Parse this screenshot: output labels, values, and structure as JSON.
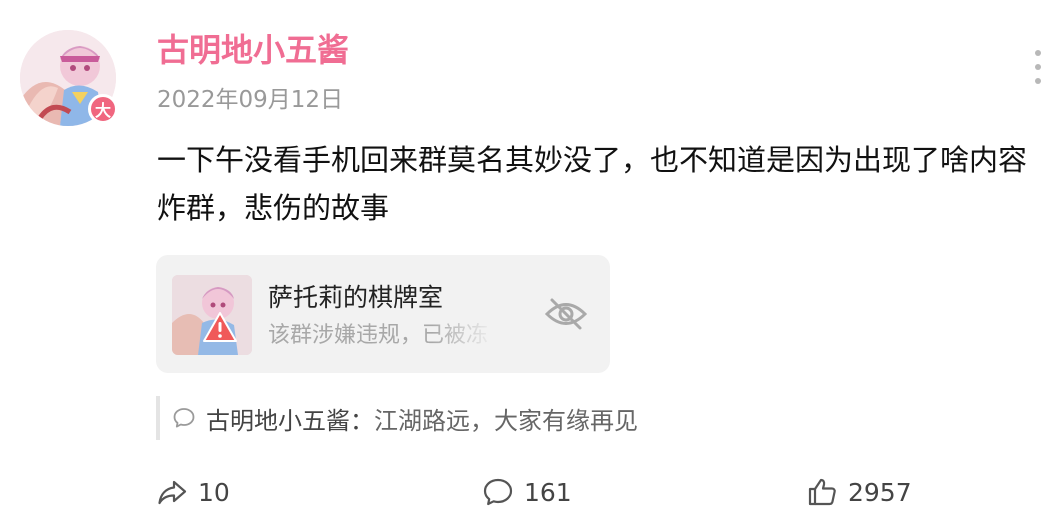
{
  "post": {
    "author": "古明地小五酱",
    "badge": "大",
    "date": "2022年09月12日",
    "content": "一下午没看手机回来群莫名其妙没了，也不知道是因为出现了啥内容炸群，悲伤的故事",
    "group_card": {
      "name": "萨托莉的棋牌室",
      "status": "该群涉嫌违规，已被冻"
    },
    "comment_preview": {
      "author": "古明地小五酱：",
      "text": "江湖路远，大家有缘再见"
    },
    "actions": {
      "share_count": "10",
      "comment_count": "161",
      "like_count": "2957"
    }
  },
  "colors": {
    "username": "#f06d93",
    "badge": "#f0667f",
    "warning": "#f05a5a"
  },
  "icons": [
    "more-icon",
    "warning-icon",
    "hidden-eye-icon",
    "comment-icon",
    "share-icon",
    "like-icon"
  ]
}
